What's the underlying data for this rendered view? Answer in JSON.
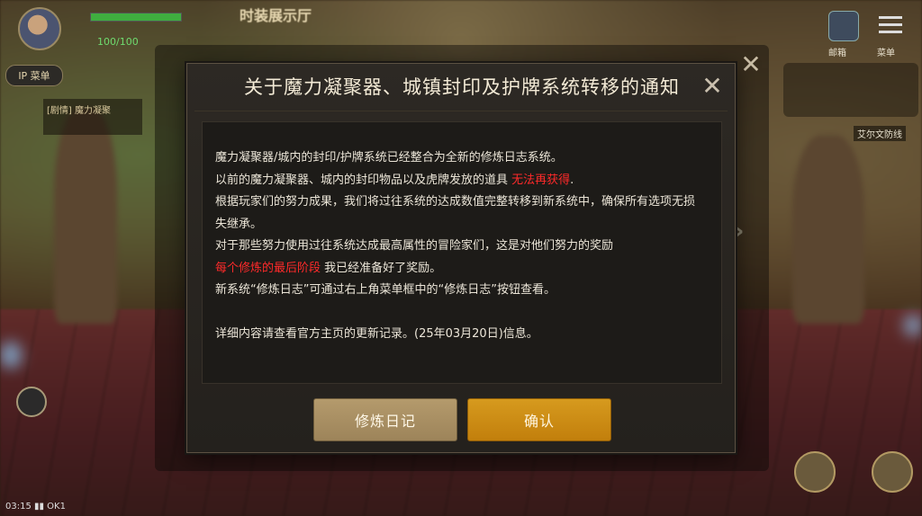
{
  "hud": {
    "hp_text": "100/100",
    "location_title": "时装展示厅",
    "menu_button": "IP 菜单",
    "quest_text": "[剧情] 魔力凝聚",
    "mail_label": "邮箱",
    "menu_label": "菜单",
    "npc_label": "艾尔文防线",
    "bottom_left": "03:15  ▮▮  OK1"
  },
  "dialog": {
    "title": "关于魔力凝聚器、城镇封印及护牌系统转移的通知",
    "lines": {
      "l1": "魔力凝聚器/城内的封印/护牌系统已经整合为全新的修炼日志系统。",
      "l2a": "以前的魔力凝聚器、城内的封印物品以及虎牌发放的道具 ",
      "l2b": "无法再获得",
      "l2c": ".",
      "l3": "根据玩家们的努力成果，我们将过往系统的达成数值完整转移到新系统中，确保所有选项无损失继承。",
      "l4": "对于那些努力使用过往系统达成最高属性的冒险家们，这是对他们努力的奖励",
      "l5a": "每个修炼的最后阶段",
      "l5b": " 我已经准备好了奖励。",
      "l6": "新系统“修炼日志”可通过右上角菜单框中的“修炼日志”按钮查看。",
      "l7": "详细内容请查看官方主页的更新记录。(25年03月20日)信息。"
    },
    "buttons": {
      "journal": "修炼日记",
      "confirm": "确认"
    }
  },
  "colors": {
    "highlight_red": "#ff2a2a",
    "confirm_gold": "#d69a1e",
    "journal_tan": "#b49a6c"
  }
}
